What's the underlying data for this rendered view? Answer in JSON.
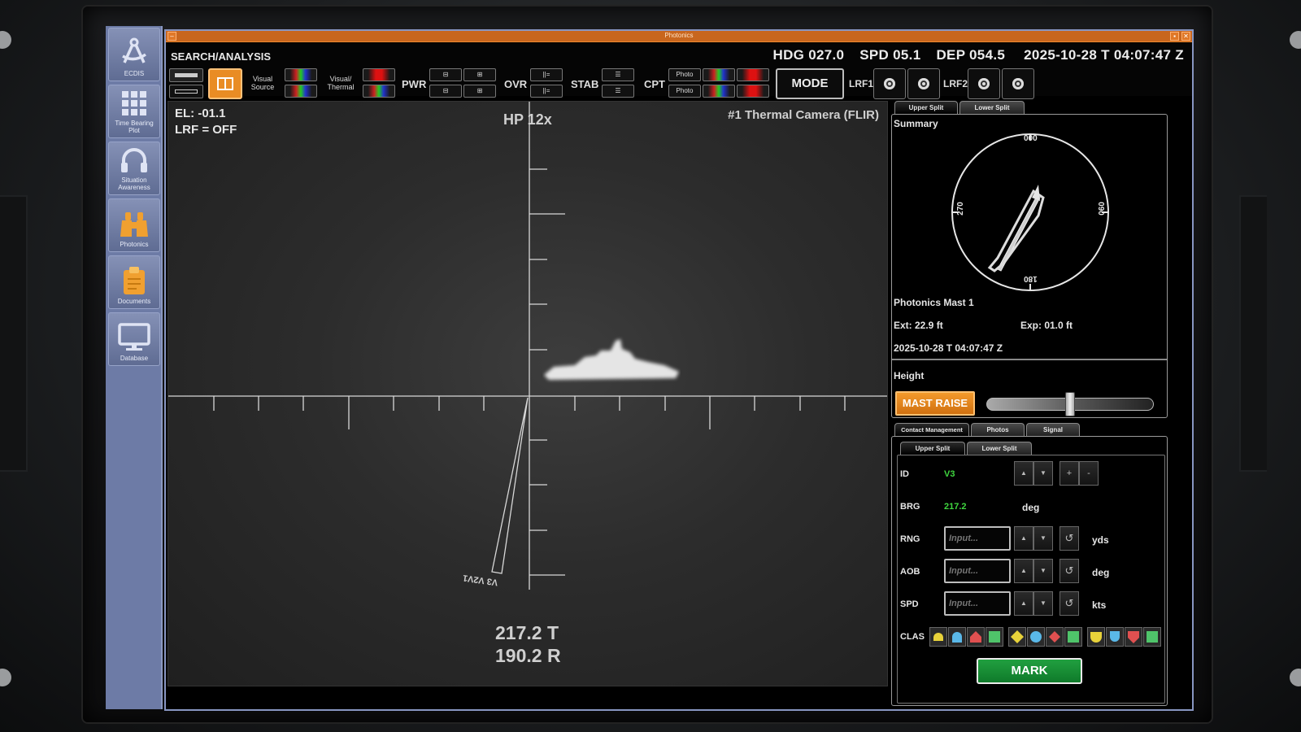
{
  "sidebar": {
    "items": [
      {
        "label": "ECDIS",
        "icon": "compass-icon"
      },
      {
        "label": "Time Bearing Plot",
        "icon": "grid-icon"
      },
      {
        "label": "Situation Awareness",
        "icon": "headphones-icon"
      },
      {
        "label": "Photonics",
        "icon": "binoculars-icon"
      },
      {
        "label": "Documents",
        "icon": "clipboard-icon"
      },
      {
        "label": "Database",
        "icon": "monitor-icon"
      }
    ]
  },
  "window": {
    "title": "Photonics"
  },
  "topbar": {
    "mode": "SEARCH/ANALYSIS",
    "hdg": "HDG 027.0",
    "spd": "SPD 05.1",
    "dep": "DEP 054.5",
    "datetime": "2025-10-28 T 04:07:47 Z",
    "visual_source": "Visual Source",
    "visual_thermal": "Visual/ Thermal",
    "pwr": "PWR",
    "ovr": "OVR",
    "stab": "STAB",
    "cpt": "CPT",
    "photo1": "Photo",
    "photo2": "Photo",
    "mode_btn": "MODE",
    "lrf1": "LRF1",
    "lrf2": "LRF2"
  },
  "camera": {
    "el": "EL: -01.1",
    "lrf": "LRF = OFF",
    "zoom": "HP 12x",
    "source": "#1 Thermal Camera (FLIR)",
    "bearing_label": "V3 V2V1",
    "brg_true": "217.2 T",
    "brg_rel": "190.2 R"
  },
  "summary": {
    "tab_upper": "Upper Split",
    "tab_lower": "Lower Split",
    "title": "Summary",
    "compass": {
      "n": "000",
      "e": "090",
      "s": "180",
      "w": "270"
    },
    "mast": "Photonics Mast 1",
    "ext": "Ext: 22.9 ft",
    "exp": "Exp: 01.0 ft",
    "datetime": "2025-10-28 T 04:07:47 Z",
    "height": "Height",
    "mast_raise": "MAST RAISE",
    "height_level_pct": 50
  },
  "contact": {
    "tabs": [
      "Contact Management",
      "Photos",
      "Signal"
    ],
    "subtabs": [
      "Upper Split",
      "Lower Split"
    ],
    "id_label": "ID",
    "id_value": "V3",
    "brg_label": "BRG",
    "brg_value": "217.2",
    "brg_unit": "deg",
    "rng_label": "RNG",
    "rng_unit": "yds",
    "aob_label": "AOB",
    "aob_unit": "deg",
    "spd_label": "SPD",
    "spd_unit": "kts",
    "input_placeholder": "Input...",
    "plus": "+",
    "minus": "-",
    "clas_label": "CLAS",
    "mark": "MARK"
  }
}
